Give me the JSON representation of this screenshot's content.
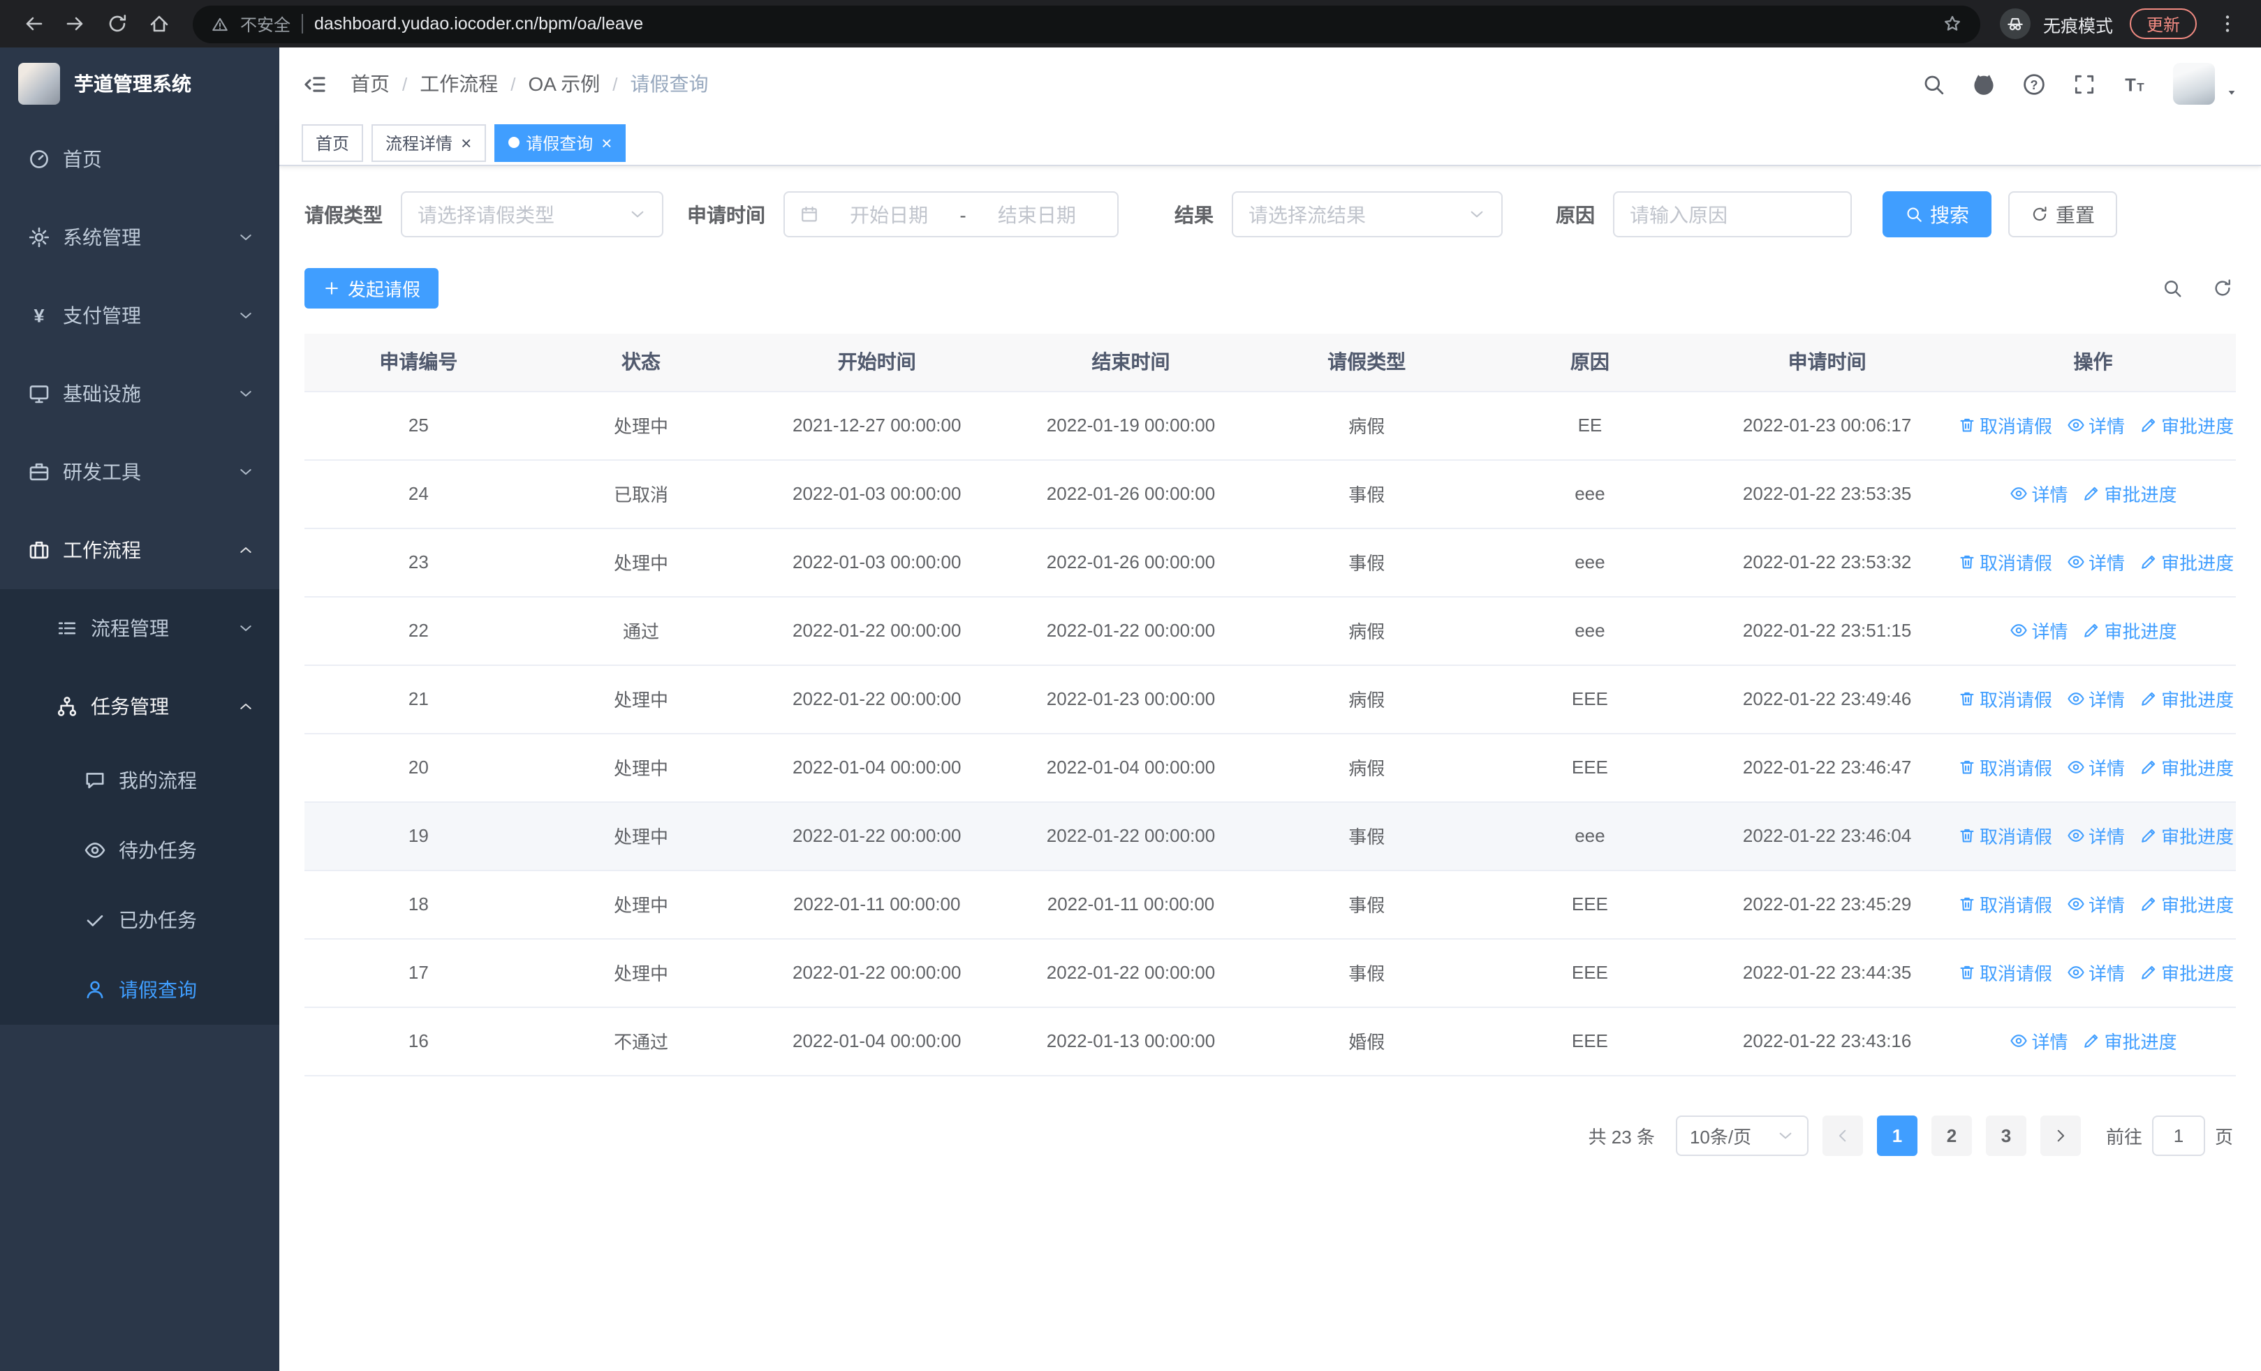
{
  "browser": {
    "security_label": "不安全",
    "url": "dashboard.yudao.iocoder.cn/bpm/oa/leave",
    "profile_label": "无痕模式",
    "update_label": "更新"
  },
  "sidebar": {
    "logo_title": "芋道管理系统",
    "menu": [
      {
        "label": "首页",
        "icon": "dashboard",
        "level": 1
      },
      {
        "label": "系统管理",
        "icon": "gear",
        "level": 1,
        "arrow": "down"
      },
      {
        "label": "支付管理",
        "icon": "yen",
        "level": 1,
        "arrow": "down"
      },
      {
        "label": "基础设施",
        "icon": "monitor",
        "level": 1,
        "arrow": "down"
      },
      {
        "label": "研发工具",
        "icon": "briefcase",
        "level": 1,
        "arrow": "down"
      },
      {
        "label": "工作流程",
        "icon": "suitcase",
        "level": 1,
        "arrow": "up",
        "open": true
      },
      {
        "label": "流程管理",
        "icon": "list",
        "level": 2,
        "arrow": "down"
      },
      {
        "label": "任务管理",
        "icon": "branch",
        "level": 2,
        "arrow": "up",
        "open": true
      },
      {
        "label": "我的流程",
        "icon": "chat",
        "level": 3
      },
      {
        "label": "待办任务",
        "icon": "eye",
        "level": 3
      },
      {
        "label": "已办任务",
        "icon": "check",
        "level": 3
      },
      {
        "label": "请假查询",
        "icon": "user",
        "level": 3,
        "active": true
      }
    ]
  },
  "breadcrumb": [
    "首页",
    "工作流程",
    "OA 示例",
    "请假查询"
  ],
  "tabs": [
    {
      "label": "首页",
      "closable": false,
      "active": false
    },
    {
      "label": "流程详情",
      "closable": true,
      "active": false
    },
    {
      "label": "请假查询",
      "closable": true,
      "active": true
    }
  ],
  "filters": {
    "leave_type_label": "请假类型",
    "leave_type_placeholder": "请选择请假类型",
    "apply_time_label": "申请时间",
    "start_date_placeholder": "开始日期",
    "date_separator": "-",
    "end_date_placeholder": "结束日期",
    "result_label": "结果",
    "result_placeholder": "请选择流结果",
    "reason_label": "原因",
    "reason_placeholder": "请输入原因",
    "search_label": "搜索",
    "reset_label": "重置"
  },
  "toolbar": {
    "create_label": "发起请假"
  },
  "table": {
    "columns": [
      "申请编号",
      "状态",
      "开始时间",
      "结束时间",
      "请假类型",
      "原因",
      "申请时间",
      "操作"
    ],
    "action_labels": {
      "cancel": "取消请假",
      "detail": "详情",
      "progress": "审批进度"
    },
    "action_icons": {
      "cancel": "trash",
      "detail": "eye",
      "progress": "pen"
    },
    "rows": [
      {
        "id": "25",
        "status": "处理中",
        "start": "2021-12-27 00:00:00",
        "end": "2022-01-19 00:00:00",
        "type": "病假",
        "reason": "EE",
        "apply_time": "2022-01-23 00:06:17",
        "actions": [
          "cancel",
          "detail",
          "progress"
        ],
        "hover": false
      },
      {
        "id": "24",
        "status": "已取消",
        "start": "2022-01-03 00:00:00",
        "end": "2022-01-26 00:00:00",
        "type": "事假",
        "reason": "eee",
        "apply_time": "2022-01-22 23:53:35",
        "actions": [
          "detail",
          "progress"
        ],
        "hover": false
      },
      {
        "id": "23",
        "status": "处理中",
        "start": "2022-01-03 00:00:00",
        "end": "2022-01-26 00:00:00",
        "type": "事假",
        "reason": "eee",
        "apply_time": "2022-01-22 23:53:32",
        "actions": [
          "cancel",
          "detail",
          "progress"
        ],
        "hover": false
      },
      {
        "id": "22",
        "status": "通过",
        "start": "2022-01-22 00:00:00",
        "end": "2022-01-22 00:00:00",
        "type": "病假",
        "reason": "eee",
        "apply_time": "2022-01-22 23:51:15",
        "actions": [
          "detail",
          "progress"
        ],
        "hover": false
      },
      {
        "id": "21",
        "status": "处理中",
        "start": "2022-01-22 00:00:00",
        "end": "2022-01-23 00:00:00",
        "type": "病假",
        "reason": "EEE",
        "apply_time": "2022-01-22 23:49:46",
        "actions": [
          "cancel",
          "detail",
          "progress"
        ],
        "hover": false
      },
      {
        "id": "20",
        "status": "处理中",
        "start": "2022-01-04 00:00:00",
        "end": "2022-01-04 00:00:00",
        "type": "病假",
        "reason": "EEE",
        "apply_time": "2022-01-22 23:46:47",
        "actions": [
          "cancel",
          "detail",
          "progress"
        ],
        "hover": false
      },
      {
        "id": "19",
        "status": "处理中",
        "start": "2022-01-22 00:00:00",
        "end": "2022-01-22 00:00:00",
        "type": "事假",
        "reason": "eee",
        "apply_time": "2022-01-22 23:46:04",
        "actions": [
          "cancel",
          "detail",
          "progress"
        ],
        "hover": true
      },
      {
        "id": "18",
        "status": "处理中",
        "start": "2022-01-11 00:00:00",
        "end": "2022-01-11 00:00:00",
        "type": "事假",
        "reason": "EEE",
        "apply_time": "2022-01-22 23:45:29",
        "actions": [
          "cancel",
          "detail",
          "progress"
        ],
        "hover": false
      },
      {
        "id": "17",
        "status": "处理中",
        "start": "2022-01-22 00:00:00",
        "end": "2022-01-22 00:00:00",
        "type": "事假",
        "reason": "EEE",
        "apply_time": "2022-01-22 23:44:35",
        "actions": [
          "cancel",
          "detail",
          "progress"
        ],
        "hover": false
      },
      {
        "id": "16",
        "status": "不通过",
        "start": "2022-01-04 00:00:00",
        "end": "2022-01-13 00:00:00",
        "type": "婚假",
        "reason": "EEE",
        "apply_time": "2022-01-22 23:43:16",
        "actions": [
          "detail",
          "progress"
        ],
        "hover": false
      }
    ]
  },
  "pagination": {
    "total_label": "共 23 条",
    "page_size_label": "10条/页",
    "pages": [
      "1",
      "2",
      "3"
    ],
    "current": "1",
    "goto_label": "前往",
    "goto_value": "1",
    "page_unit": "页"
  },
  "colors": {
    "primary": "#409eff",
    "sidebar_bg": "#2b3749",
    "submenu_bg": "#212d3d"
  }
}
